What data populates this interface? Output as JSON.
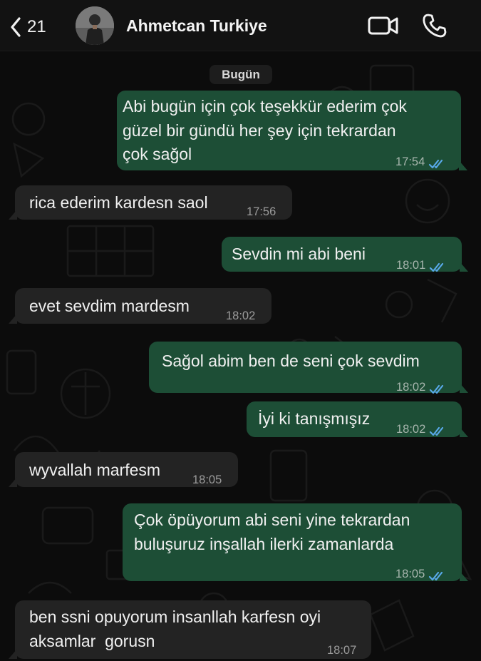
{
  "header": {
    "back_count": "21",
    "contact_name": "Ahmetcan Turkiye",
    "icons": {
      "back": "chevron-left-icon",
      "video": "video-camera-icon",
      "call": "phone-icon"
    }
  },
  "chat": {
    "date_divider": "Bugün",
    "messages": [
      {
        "direction": "out",
        "text": "Abi bugün için çok teşekkür ederim çok\ngüzel bir gündü her şey için tekrardan\nçok sağol",
        "time": "17:54",
        "status": "read"
      },
      {
        "direction": "in",
        "text": "rica ederim kardesn saol",
        "time": "17:56"
      },
      {
        "direction": "out",
        "text": "Sevdin mi abi beni",
        "time": "18:01",
        "status": "read"
      },
      {
        "direction": "in",
        "text": "evet sevdim mardesm",
        "time": "18:02"
      },
      {
        "direction": "out",
        "text": "Sağol abim ben de seni çok sevdim",
        "time": "18:02",
        "status": "read"
      },
      {
        "direction": "out",
        "text": "İyi ki tanışmışız",
        "time": "18:02",
        "status": "read"
      },
      {
        "direction": "in",
        "text": "wyvallah marfesm",
        "time": "18:05"
      },
      {
        "direction": "out",
        "text": "Çok öpüyorum abi seni yine tekrardan\nbuluşuruz inşallah ilerki zamanlarda",
        "time": "18:05",
        "status": "read"
      },
      {
        "direction": "in",
        "text": "ben ssni opuyorum insanllah karfesn oyi\naksamlar  gorusn",
        "time": "18:07"
      }
    ]
  },
  "colors": {
    "outgoing_bubble": "#1d4e36",
    "incoming_bubble": "#232323",
    "read_ticks": "#58a8e8",
    "background": "#0c0c0c"
  }
}
